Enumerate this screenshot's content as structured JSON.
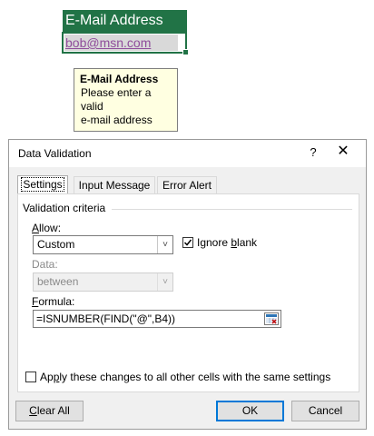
{
  "sheet": {
    "header": "E-Mail Address",
    "cell_value": "bob@msn.com",
    "tooltip_title": "E-Mail Address",
    "tooltip_line1": "Please enter a valid",
    "tooltip_line2": "e-mail address"
  },
  "dialog": {
    "title": "Data Validation",
    "help": "?",
    "close": "✕",
    "tabs": [
      {
        "label": "Settings",
        "active": true
      },
      {
        "label": "Input Message",
        "active": false
      },
      {
        "label": "Error Alert",
        "active": false
      }
    ],
    "group_label": "Validation criteria",
    "allow": {
      "label_pre": "",
      "label_acc": "A",
      "label_post": "llow:",
      "value": "Custom"
    },
    "ignore_blank": {
      "checked": true,
      "label_pre": "Ignore ",
      "label_acc": "b",
      "label_post": "lank"
    },
    "data": {
      "label": "Data:",
      "value": "between",
      "disabled": true
    },
    "formula": {
      "label_acc": "F",
      "label_post": "ormula:",
      "value": "=ISNUMBER(FIND(\"@\",B4))"
    },
    "apply_all": {
      "checked": false,
      "label_pre": "Ap",
      "label_acc": "p",
      "label_post": "ly these changes to all other cells with the same settings"
    },
    "buttons": {
      "clear_acc": "C",
      "clear_post": "lear All",
      "ok": "OK",
      "cancel": "Cancel"
    },
    "colors": {
      "excel_green": "#217346",
      "link_purple": "#8f4d9b",
      "tooltip_bg": "#ffffe1",
      "ok_border": "#0078d7"
    }
  }
}
